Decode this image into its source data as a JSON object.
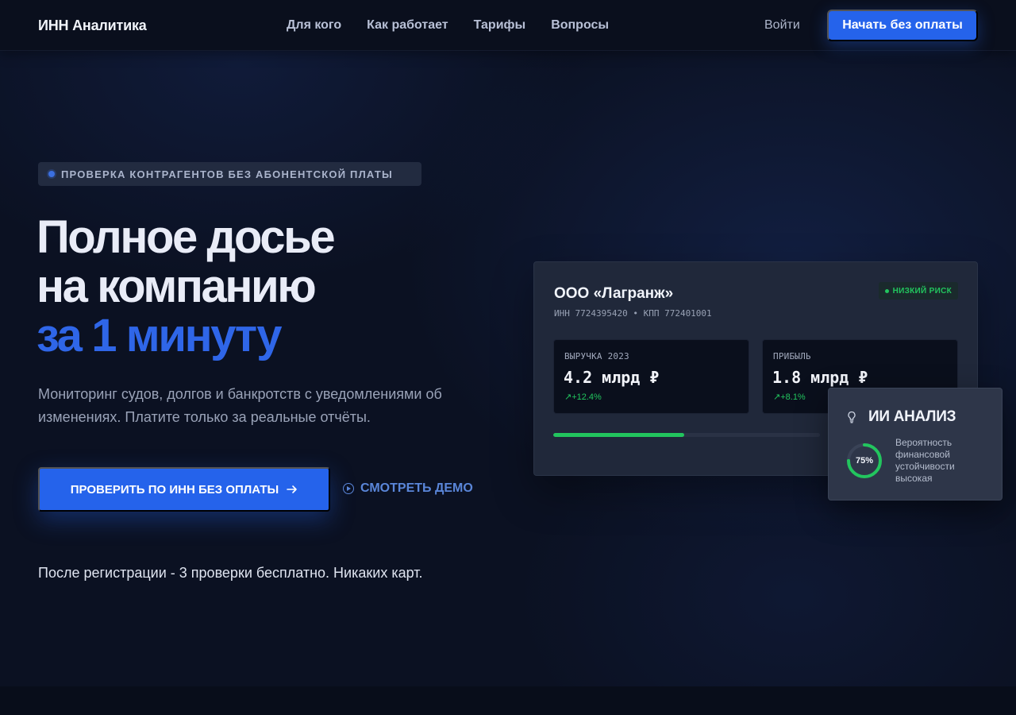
{
  "nav": {
    "logo": "ИНН Аналитика",
    "links": [
      "Для кого",
      "Как работает",
      "Тарифы",
      "Вопросы"
    ],
    "login": "Войти",
    "cta": "Начать без оплаты"
  },
  "hero": {
    "badge": "ПРОВЕРКА КОНТРАГЕНТОВ БЕЗ АБОНЕНТСКОЙ ПЛАТЫ",
    "title_line1": "Полное досье",
    "title_line2": "на компанию",
    "title_accent": "за 1 минуту",
    "subtitle": "Мониторинг судов, долгов и банкротств с уведомлениями об изменениях. Платите только за реальные отчёты.",
    "cta_primary": "ПРОВЕРИТЬ ПО ИНН БЕЗ ОПЛАТЫ",
    "cta_secondary": "СМОТРЕТЬ ДЕМО",
    "note": "После регистрации - 3 проверки бесплатно. Никаких карт."
  },
  "company_card": {
    "name": "ООО «Лагранж»",
    "ids": "ИНН 7724395420 • КПП 772401001",
    "risk_badge": "НИЗКИЙ РИСК",
    "metrics": [
      {
        "label": "ВЫРУЧКА 2023",
        "value": "4.2 млрд ₽",
        "delta": "+12.4%"
      },
      {
        "label": "ПРИБЫЛЬ",
        "value": "1.8 млрд ₽",
        "delta": "+8.1%"
      }
    ],
    "progress_fraction": 0.49
  },
  "ai_card": {
    "title": "ИИ АНАЛИЗ",
    "gauge_value": "75%",
    "gauge_fraction": 0.75,
    "description": "Вероятность финансовой устойчивости высокая"
  },
  "colors": {
    "accent": "#2563eb",
    "success": "#22c55e",
    "background": "#0b1122"
  }
}
